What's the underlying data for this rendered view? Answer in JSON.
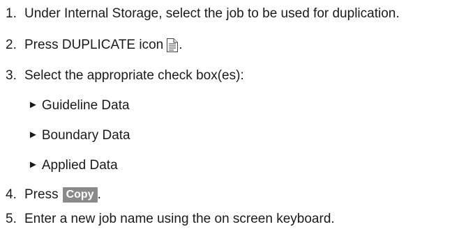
{
  "steps": [
    {
      "number": "1.",
      "text": "Under Internal Storage, select the job to be used for duplication."
    },
    {
      "number": "2.",
      "text_before": "Press DUPLICATE icon",
      "icon": "duplicate-document-icon",
      "text_after": "."
    },
    {
      "number": "3.",
      "text": "Select the appropriate check box(es):"
    },
    {
      "number": "4.",
      "text_before": "Press",
      "button_label": "Copy",
      "text_after": "."
    },
    {
      "number": "5.",
      "text": "Enter a new job name using the on screen keyboard."
    }
  ],
  "sub_items": [
    {
      "bullet": "►",
      "label": "Guideline Data"
    },
    {
      "bullet": "►",
      "label": "Boundary Data"
    },
    {
      "bullet": "►",
      "label": "Applied Data"
    }
  ],
  "colors": {
    "text": "#1a1a1a",
    "copy_button_bg": "#8a8a8a",
    "copy_button_text": "#ffffff"
  }
}
